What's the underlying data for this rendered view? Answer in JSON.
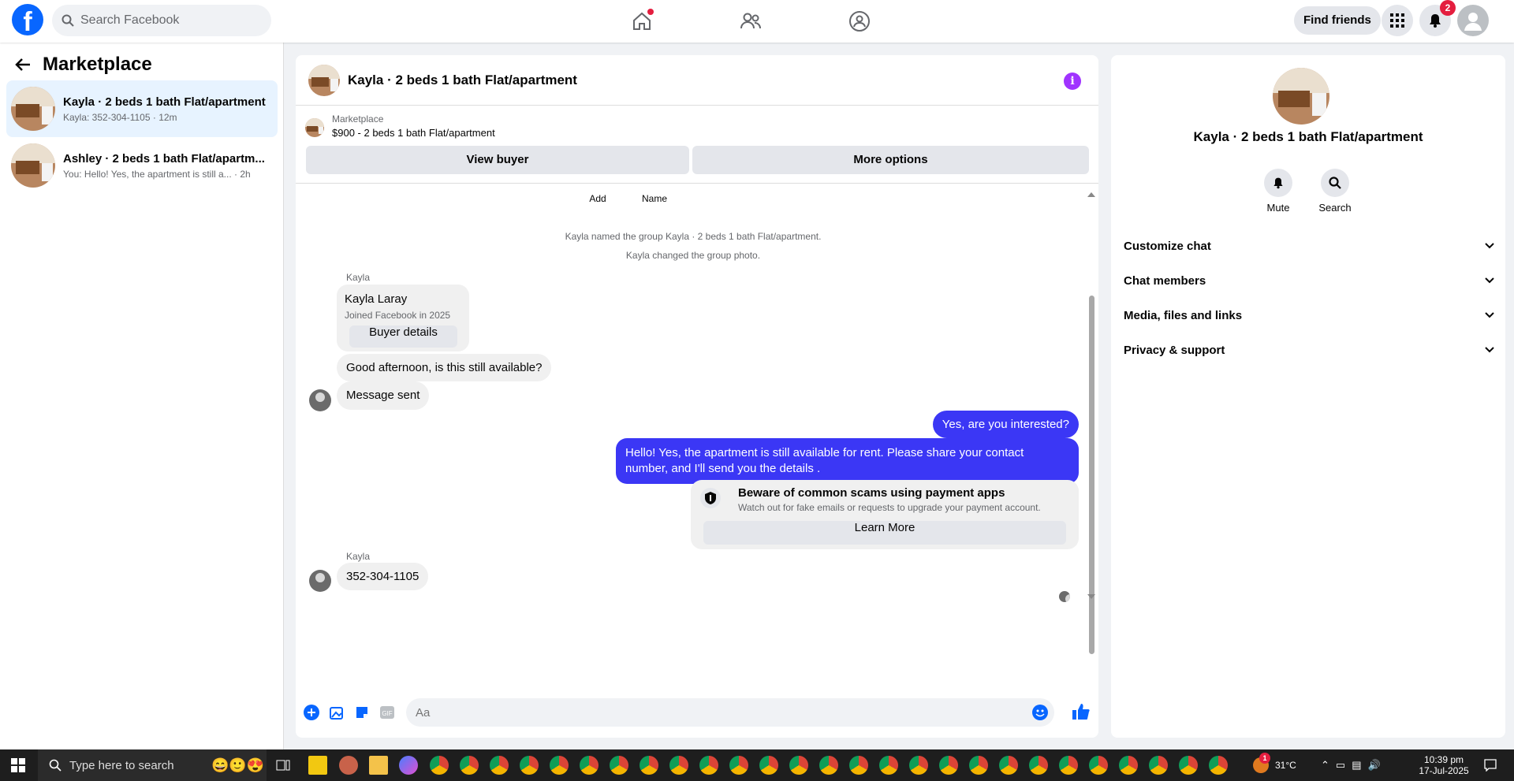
{
  "top": {
    "search_placeholder": "Search Facebook",
    "find_friends": "Find friends",
    "notif_count": "2"
  },
  "sidebar": {
    "title": "Marketplace",
    "items": [
      {
        "name": "Kayla · 2 beds 1 bath Flat/apartment",
        "sub": "Kayla: 352-304-1105 · 12m"
      },
      {
        "name": "Ashley · 2 beds 1 bath Flat/apartm...",
        "sub": "You: Hello! Yes, the apartment is still a... · 2h"
      }
    ]
  },
  "chat": {
    "title": "Kayla · 2 beds 1 bath Flat/apartment",
    "mp_label": "Marketplace",
    "mp_listing": "$900 - 2 beds 1 bath Flat/apartment",
    "view_buyer": "View buyer",
    "more_options": "More options",
    "add_label": "Add",
    "name_label": "Name",
    "sys1": "Kayla named the group Kayla · 2 beds 1 bath Flat/apartment.",
    "sys2": "Kayla changed the group photo.",
    "sender1": "Kayla",
    "card_name": "Kayla Laray",
    "card_joined": "Joined Facebook in 2025",
    "buyer_details": "Buyer details",
    "msg1": "Good afternoon, is this still available?",
    "msg2": "Message sent",
    "out1": "Yes, are you interested?",
    "out2": "Hello! Yes, the apartment is still available for rent. Please share your contact number, and I'll send you the details .",
    "warn_title": "Beware of common scams using payment apps",
    "warn_body": "Watch out for fake emails or requests to upgrade your payment account.",
    "learn_more": "Learn More",
    "sender2": "Kayla",
    "msg3": "352-304-1105",
    "compose_placeholder": "Aa"
  },
  "details": {
    "title": "Kayla · 2 beds 1 bath Flat/apartment",
    "mute": "Mute",
    "search": "Search",
    "sections": [
      "Customize chat",
      "Chat members",
      "Media, files and links",
      "Privacy & support"
    ]
  },
  "taskbar": {
    "search_placeholder": "Type here to search",
    "temp": "31°C",
    "time": "10:39 pm",
    "date": "17-Jul-2025",
    "alert_count": "1"
  },
  "colors": {
    "brand": "#0866ff",
    "outgoing": "#3b37f5",
    "info": "#a033ff"
  }
}
